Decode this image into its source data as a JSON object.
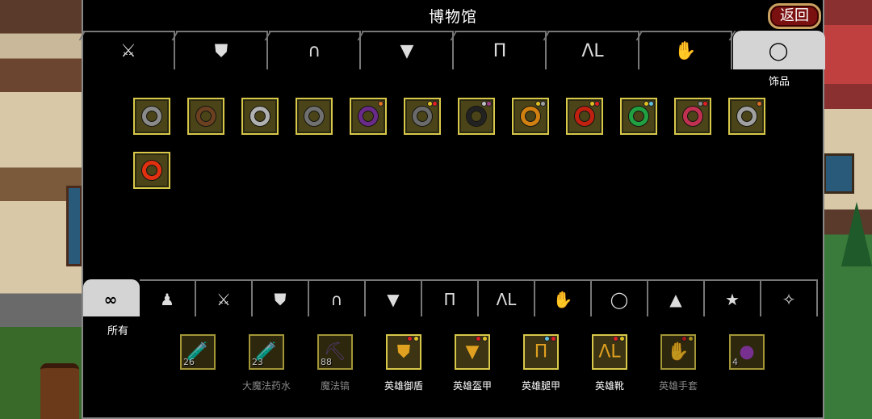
{
  "title": "博物馆",
  "back_label": "返回",
  "top_tabs": [
    {
      "id": "weapon",
      "icon": "sword-icon",
      "glyph": "⚔"
    },
    {
      "id": "shield",
      "icon": "shield-icon",
      "glyph": "⛊"
    },
    {
      "id": "helmet",
      "icon": "helmet-icon",
      "glyph": "∩"
    },
    {
      "id": "armor",
      "icon": "armor-icon",
      "glyph": "▼"
    },
    {
      "id": "legs",
      "icon": "legs-icon",
      "glyph": "Π"
    },
    {
      "id": "boots",
      "icon": "boots-icon",
      "glyph": "ɅL"
    },
    {
      "id": "gloves",
      "icon": "glove-icon",
      "glyph": "✋"
    },
    {
      "id": "accessory",
      "icon": "ring-icon",
      "glyph": "◯",
      "active": true
    }
  ],
  "active_top_label": "饰品",
  "rings": [
    {
      "color": "#8a8a8a",
      "gems": []
    },
    {
      "color": "#6a4020",
      "gems": []
    },
    {
      "color": "#b0b0b0",
      "gems": []
    },
    {
      "color": "#707070",
      "gems": []
    },
    {
      "color": "#6a2a8a",
      "gems": [
        "#e07020"
      ]
    },
    {
      "color": "#6a6a6a",
      "gems": [
        "#e02020",
        "#e0c020"
      ]
    },
    {
      "color": "#222222",
      "gems": [
        "#a04080",
        "#c0c0c0"
      ]
    },
    {
      "color": "#d08010",
      "gems": [
        "#a0a0a0",
        "#e0c020"
      ]
    },
    {
      "color": "#c02010",
      "gems": [
        "#e02020",
        "#e0c020"
      ]
    },
    {
      "color": "#20a040",
      "gems": [
        "#60c0e0",
        "#e0c020"
      ]
    },
    {
      "color": "#c03050",
      "gems": [
        "#e02020",
        "#888888"
      ]
    },
    {
      "color": "#a0a0a0",
      "gems": [
        "#e07020"
      ]
    },
    {
      "color": "#e03010",
      "gems": []
    }
  ],
  "bottom_tabs": [
    {
      "id": "all",
      "icon": "infinity-icon",
      "glyph": "∞",
      "active": true
    },
    {
      "id": "consumable",
      "icon": "bag-icon",
      "glyph": "♟"
    },
    {
      "id": "weapon",
      "icon": "sword-icon",
      "glyph": "⚔"
    },
    {
      "id": "shield",
      "icon": "shield-icon",
      "glyph": "⛊"
    },
    {
      "id": "helmet",
      "icon": "helmet-icon",
      "glyph": "∩"
    },
    {
      "id": "armor",
      "icon": "armor-icon",
      "glyph": "▼"
    },
    {
      "id": "legs",
      "icon": "legs-icon",
      "glyph": "Π"
    },
    {
      "id": "boots",
      "icon": "boots-icon",
      "glyph": "ɅL"
    },
    {
      "id": "gloves",
      "icon": "glove-icon",
      "glyph": "✋"
    },
    {
      "id": "ring",
      "icon": "ring-icon",
      "glyph": "◯"
    },
    {
      "id": "material",
      "icon": "hill-icon",
      "glyph": "▲"
    },
    {
      "id": "special",
      "icon": "star-icon",
      "glyph": "★"
    },
    {
      "id": "magic",
      "icon": "wand-icon",
      "glyph": "✧"
    }
  ],
  "active_bottom_label": "所有",
  "inventory": [
    {
      "name": "",
      "count": "26",
      "glyph": "🧪",
      "color": "#c02020",
      "dim": true,
      "gems": []
    },
    {
      "name": "大魔法药水",
      "count": "23",
      "glyph": "🧪",
      "color": "#40a0a0",
      "dim": true,
      "gems": []
    },
    {
      "name": "魔法镐",
      "count": "88",
      "glyph": "⛏",
      "color": "#6a4a8a",
      "dim": true,
      "gems": []
    },
    {
      "name": "英雄御盾",
      "count": "",
      "glyph": "⛊",
      "color": "#e0a020",
      "dim": false,
      "gems": [
        "#e02020",
        "#e0c020"
      ]
    },
    {
      "name": "英雄盔甲",
      "count": "",
      "glyph": "▼",
      "color": "#e0a020",
      "dim": false,
      "gems": [
        "#e02020",
        "#e0c020"
      ]
    },
    {
      "name": "英雄腿甲",
      "count": "",
      "glyph": "Π",
      "color": "#e0a020",
      "dim": false,
      "gems": [
        "#60c0e0",
        "#e02020"
      ]
    },
    {
      "name": "英雄靴",
      "count": "",
      "glyph": "ɅL",
      "color": "#e0a020",
      "dim": false,
      "gems": [
        "#e02020",
        "#e0c020"
      ]
    },
    {
      "name": "英雄手套",
      "count": "",
      "glyph": "✋",
      "color": "#e0a020",
      "dim": true,
      "gems": [
        "#e02020",
        "#e0c020"
      ]
    },
    {
      "name": "",
      "count": "4",
      "glyph": "●",
      "color": "#a040c0",
      "dim": true,
      "gems": []
    }
  ]
}
